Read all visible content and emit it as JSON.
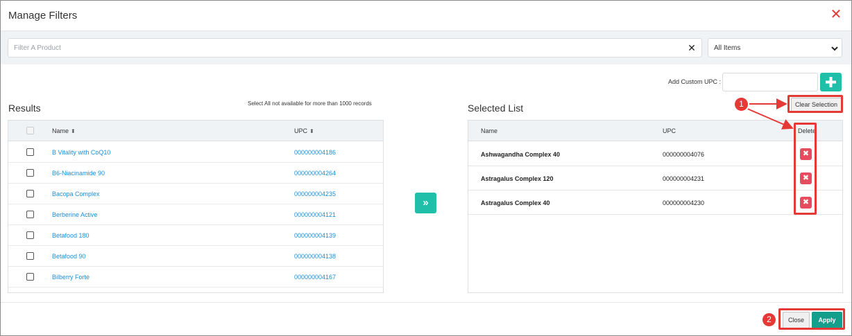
{
  "modal": {
    "title": "Manage Filters",
    "close_icon": "close-icon"
  },
  "filter": {
    "placeholder": "Filter A Product",
    "clear_icon": "clear-icon",
    "select_value": "All Items",
    "select_icon": "chevron-down-icon"
  },
  "custom_upc": {
    "label": "Add Custom UPC :",
    "add_icon": "plus-icon"
  },
  "results": {
    "title": "Results",
    "note": "Select All not available for more than 1000 records",
    "columns": {
      "name": "Name",
      "upc": "UPC",
      "sort_glyph": "⬍"
    },
    "rows": [
      {
        "name": "B Vitality with CoQ10",
        "upc": "000000004186"
      },
      {
        "name": "B6-Niacinamide 90",
        "upc": "000000004264"
      },
      {
        "name": "Bacopa Complex",
        "upc": "000000004235"
      },
      {
        "name": "Berberine Active",
        "upc": "000000004121"
      },
      {
        "name": "Betafood 180",
        "upc": "000000004139"
      },
      {
        "name": "Betafood 90",
        "upc": "000000004138"
      },
      {
        "name": "Bilberry Forte",
        "upc": "000000004167"
      }
    ]
  },
  "move_button": {
    "label": "»"
  },
  "selected": {
    "title": "Selected List",
    "clear_label": "Clear Selection",
    "columns": {
      "name": "Name",
      "upc": "UPC",
      "delete": "Delete"
    },
    "delete_glyph": "✖",
    "rows": [
      {
        "name": "Ashwagandha Complex 40",
        "upc": "000000004076"
      },
      {
        "name": "Astragalus Complex 120",
        "upc": "000000004231"
      },
      {
        "name": "Astragalus Complex 40",
        "upc": "000000004230"
      }
    ]
  },
  "footer": {
    "close_label": "Close",
    "apply_label": "Apply"
  },
  "annotations": {
    "badge_1": "1",
    "badge_2": "2",
    "color": "#e53935"
  },
  "colors": {
    "accent": "#1fbfa9",
    "apply": "#149e8c",
    "delete": "#e74c5e",
    "link": "#1a8fd8"
  }
}
